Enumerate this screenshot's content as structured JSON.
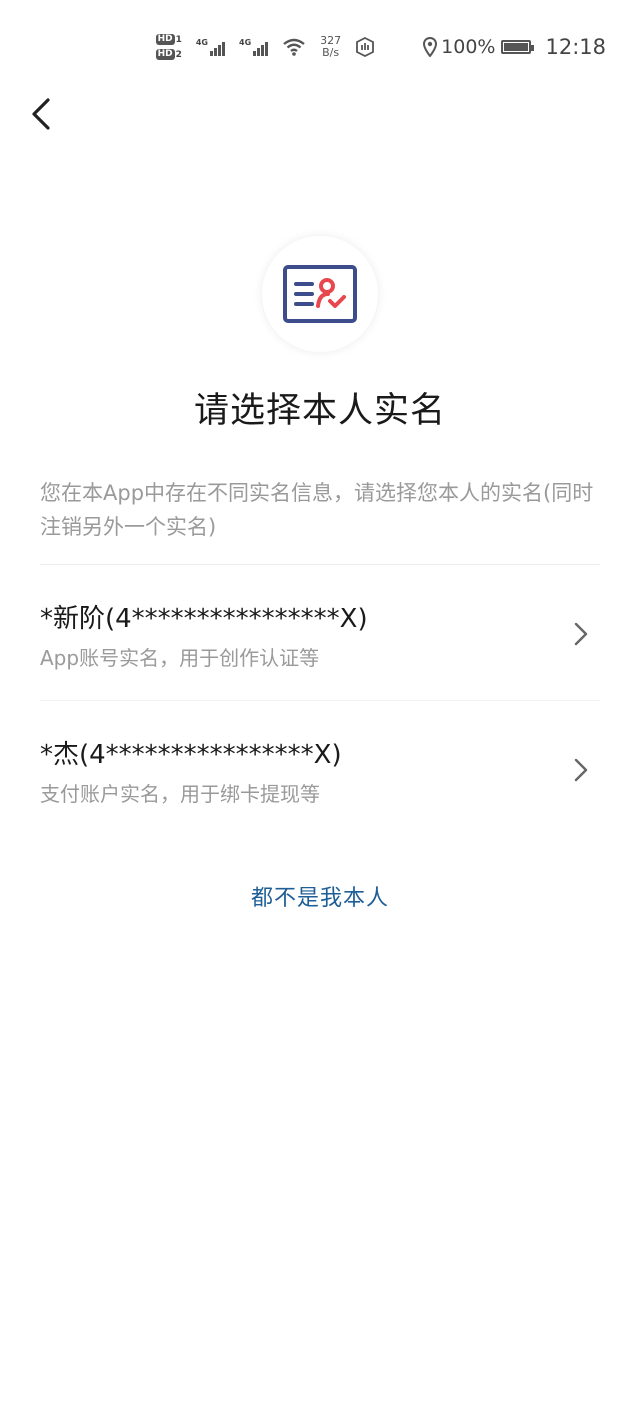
{
  "status_bar": {
    "hd1": "HD",
    "hd1_sub": "1",
    "hd2": "HD",
    "hd2_sub": "2",
    "net1": "4G",
    "net2": "4G",
    "speed_value": "327",
    "speed_unit": "B/s",
    "battery": "100%",
    "time": "12:18"
  },
  "page": {
    "title": "请选择本人实名",
    "description": "您在本App中存在不同实名信息，请选择您本人的实名(同时注销另外一个实名)"
  },
  "options": [
    {
      "name": "*新阶(4****************X)",
      "desc": "App账号实名，用于创作认证等"
    },
    {
      "name": "*杰(4****************X)",
      "desc": "支付账户实名，用于绑卡提现等"
    }
  ],
  "footer": {
    "none_link": "都不是我本人"
  },
  "colors": {
    "accent_link": "#1f5f96",
    "icon_blue": "#3d4d8c",
    "icon_red": "#e8474d"
  }
}
